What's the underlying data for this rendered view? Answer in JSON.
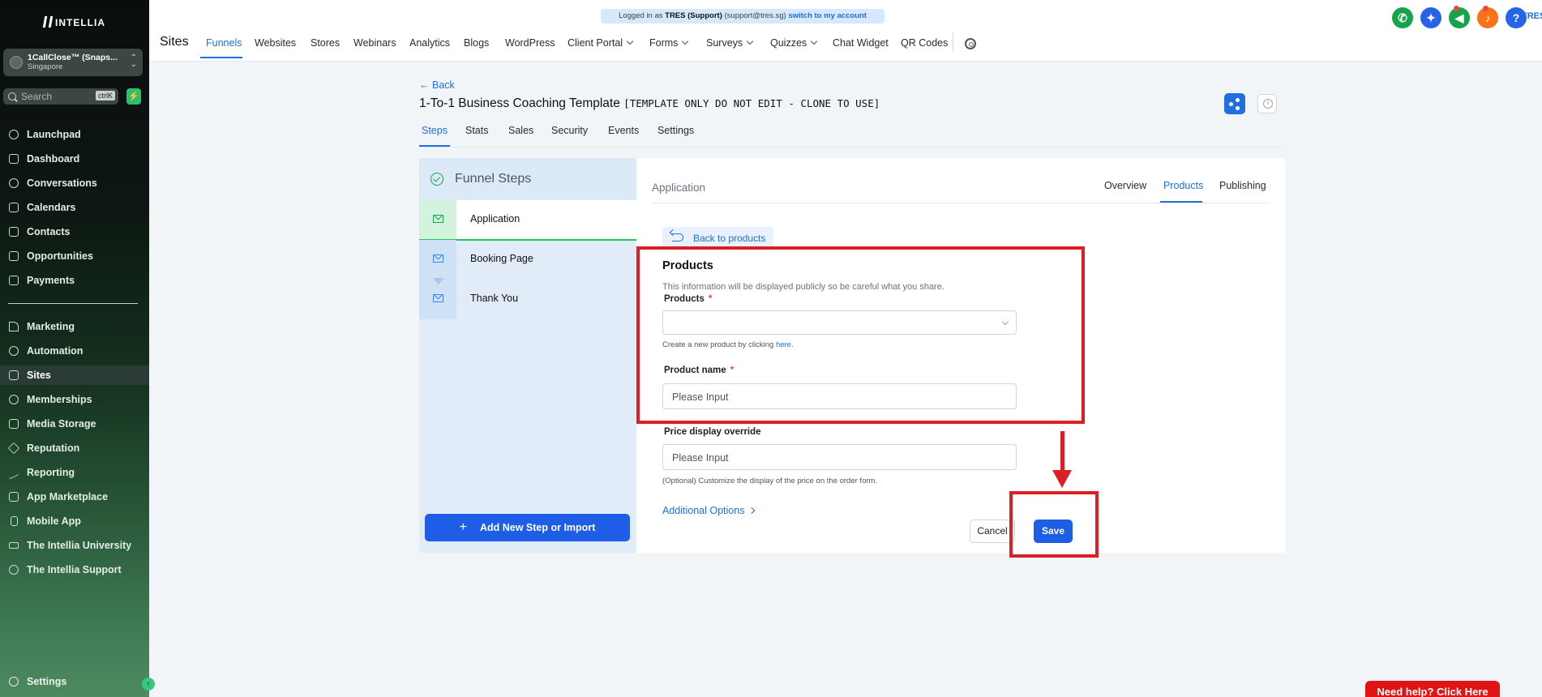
{
  "app": {
    "brand": "INTELLIA",
    "location": {
      "name": "1CallClose™ (Snaps...",
      "region": "Singapore"
    },
    "search": {
      "placeholder": "Search",
      "shortcut": "ctrlK"
    }
  },
  "sidebar": {
    "items": [
      {
        "label": "Launchpad",
        "icon": "rocket-icon"
      },
      {
        "label": "Dashboard",
        "icon": "grid-icon"
      },
      {
        "label": "Conversations",
        "icon": "chat-icon"
      },
      {
        "label": "Calendars",
        "icon": "calendar-icon"
      },
      {
        "label": "Contacts",
        "icon": "contacts-icon"
      },
      {
        "label": "Opportunities",
        "icon": "opportunities-icon"
      },
      {
        "label": "Payments",
        "icon": "payments-icon"
      },
      {
        "label": "Marketing",
        "icon": "send-icon"
      },
      {
        "label": "Automation",
        "icon": "automation-icon"
      },
      {
        "label": "Sites",
        "icon": "sites-icon",
        "active": true
      },
      {
        "label": "Memberships",
        "icon": "memberships-icon"
      },
      {
        "label": "Media Storage",
        "icon": "image-icon"
      },
      {
        "label": "Reputation",
        "icon": "star-icon"
      },
      {
        "label": "Reporting",
        "icon": "chart-line-icon"
      },
      {
        "label": "App Marketplace",
        "icon": "apps-icon"
      },
      {
        "label": "Mobile App",
        "icon": "phone-icon"
      },
      {
        "label": "The Intellia University",
        "icon": "graduation-cap-icon"
      },
      {
        "label": "The Intellia Support",
        "icon": "headset-icon"
      }
    ],
    "settings_label": "Settings"
  },
  "banner": {
    "prefix": "Logged in as",
    "user": "TRES (Support)",
    "email": "(support@tres.sg)",
    "link": "switch to my account"
  },
  "topnav": {
    "title": "Sites",
    "tabs": [
      "Funnels",
      "Websites",
      "Stores",
      "Webinars",
      "Analytics",
      "Blogs",
      "WordPress",
      "Client Portal",
      "Forms",
      "Surveys",
      "Quizzes",
      "Chat Widget",
      "QR Codes"
    ],
    "active_tab": "Funnels",
    "user_initials": "TRES",
    "icon_colors": {
      "phone": "#16a34a",
      "magic": "#2563eb",
      "megaphone": "#16a34a",
      "bell": "#f97316",
      "help": "#2563eb"
    }
  },
  "page": {
    "back_label": "Back",
    "title": "1-To-1 Business Coaching Template",
    "title_tag": "[TEMPLATE ONLY DO NOT EDIT - CLONE TO USE]",
    "subtabs": [
      "Steps",
      "Stats",
      "Sales",
      "Security",
      "Events",
      "Settings"
    ],
    "active_subtab": "Steps"
  },
  "funnel_steps": {
    "heading": "Funnel Steps",
    "steps": [
      {
        "label": "Application",
        "active": true
      },
      {
        "label": "Booking Page"
      },
      {
        "label": "Thank You"
      }
    ],
    "add_button": "Add New Step or Import"
  },
  "editor": {
    "step_title": "Application",
    "tabs": [
      "Overview",
      "Products",
      "Publishing"
    ],
    "active_tab": "Products",
    "back_to_products": "Back to products",
    "section_title": "Products",
    "section_description": "This information will be displayed publicly so be careful what you share.",
    "products_label": "Products",
    "products_value": "",
    "create_hint_prefix": "Create a new product by clicking",
    "create_hint_link": "here.",
    "product_name_label": "Product name",
    "product_name_placeholder": "Please Input",
    "price_override_label": "Price display override",
    "price_override_placeholder": "Please Input",
    "price_override_hint": "(Optional) Customize the display of the price on the order form.",
    "additional_options": "Additional Options",
    "cancel_label": "Cancel",
    "save_label": "Save",
    "required_marker": "*"
  },
  "help_widget": {
    "label": "Need help? Click Here"
  },
  "colors": {
    "accent": "#1e6fe0",
    "primary_button": "#1e5ee6",
    "annotation": "#dc1f26",
    "success": "#16a34a"
  }
}
